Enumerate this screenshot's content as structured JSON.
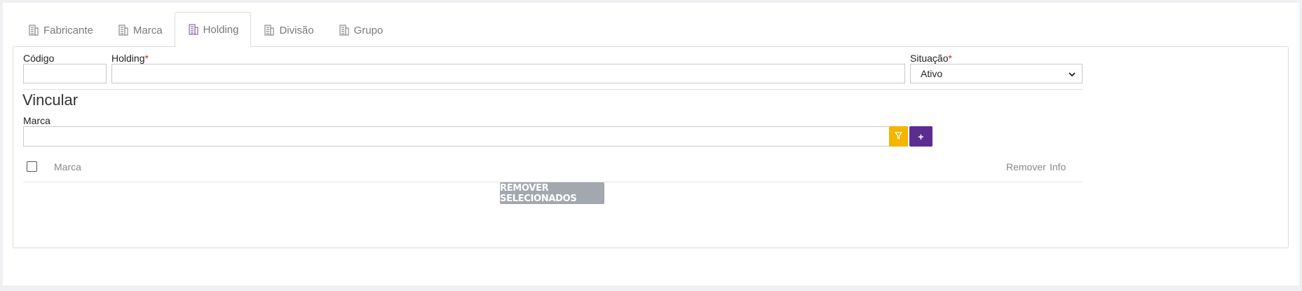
{
  "tabs": [
    {
      "label": "Fabricante",
      "icon": "building-icon"
    },
    {
      "label": "Marca",
      "icon": "building-icon"
    },
    {
      "label": "Holding",
      "icon": "building-icon",
      "active": true
    },
    {
      "label": "Divisão",
      "icon": "building-icon"
    },
    {
      "label": "Grupo",
      "icon": "building-icon"
    }
  ],
  "form": {
    "codigo_label": "Código",
    "codigo_value": "",
    "holding_label": "Holding",
    "holding_value": "",
    "required_mark": "*",
    "situacao_label": "Situação",
    "situacao_value": "Ativo"
  },
  "vincular": {
    "title": "Vincular",
    "marca_label": "Marca",
    "marca_value": "",
    "add_label": "+"
  },
  "table": {
    "columns": {
      "marca": "Marca",
      "remover": "Remover",
      "info": "Info"
    },
    "rows": []
  },
  "actions": {
    "remove_selected_label": "REMOVER SELECIONADOS"
  },
  "colors": {
    "filter_button": "#f5b400",
    "add_button": "#5c2d91",
    "remove_button": "#a3a8af",
    "required": "#e02020"
  }
}
